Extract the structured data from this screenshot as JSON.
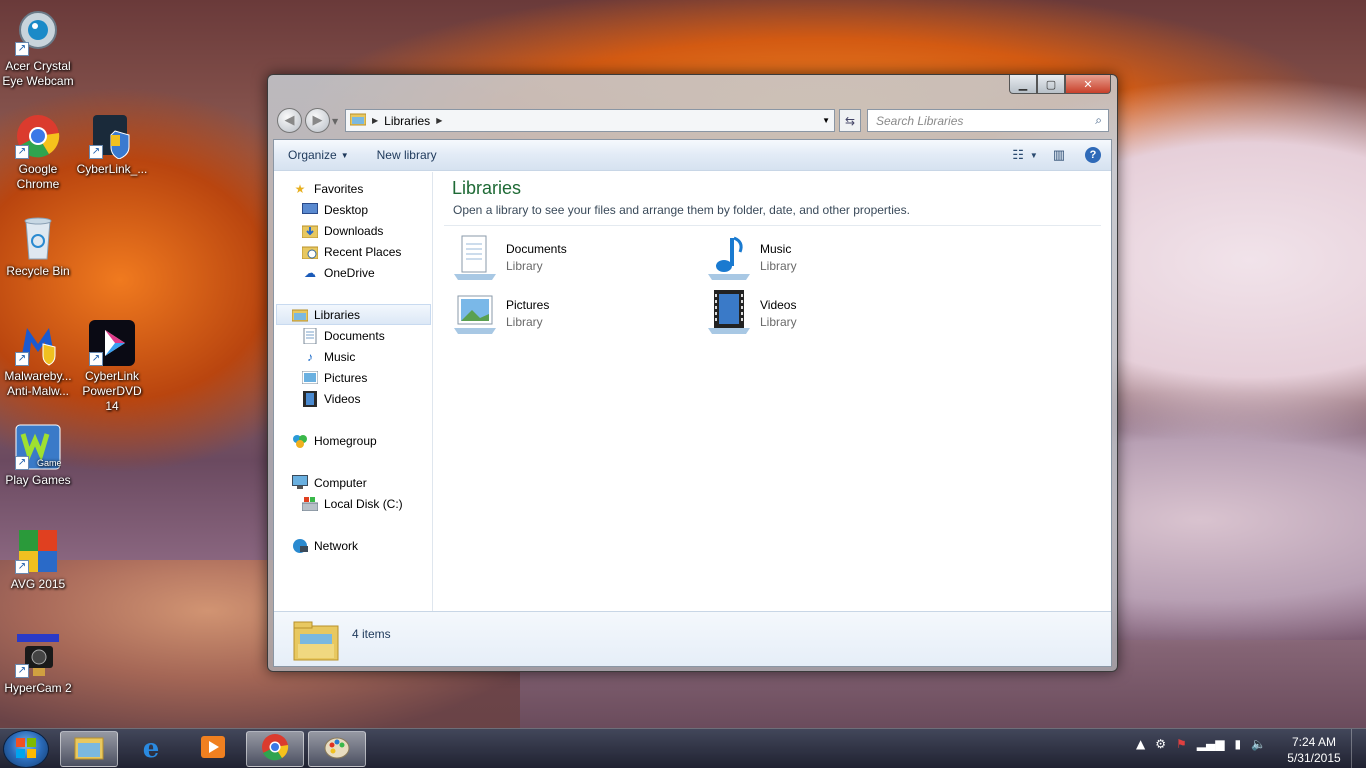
{
  "desktop": {
    "icons": [
      {
        "label": "Acer Crystal Eye Webcam"
      },
      {
        "label": "Google Chrome"
      },
      {
        "label": "CyberLink_..."
      },
      {
        "label": "Recycle Bin"
      },
      {
        "label": "Malwareby... Anti-Malw..."
      },
      {
        "label": "CyberLink PowerDVD 14"
      },
      {
        "label": "Play Games"
      },
      {
        "label": "AVG 2015"
      },
      {
        "label": "HyperCam 2"
      }
    ]
  },
  "window": {
    "address": {
      "crumb": "Libraries"
    },
    "search": {
      "placeholder": "Search Libraries"
    },
    "toolbar": {
      "organize": "Organize",
      "new_library": "New library"
    },
    "nav": {
      "favorites": "Favorites",
      "desktop": "Desktop",
      "downloads": "Downloads",
      "recent": "Recent Places",
      "onedrive": "OneDrive",
      "libraries": "Libraries",
      "documents": "Documents",
      "music": "Music",
      "pictures": "Pictures",
      "videos": "Videos",
      "homegroup": "Homegroup",
      "computer": "Computer",
      "local_disk": "Local Disk (C:)",
      "network": "Network"
    },
    "main": {
      "title": "Libraries",
      "subtitle": "Open a library to see your files and arrange them by folder, date, and other properties.",
      "libraries": [
        {
          "name": "Documents",
          "type": "Library"
        },
        {
          "name": "Music",
          "type": "Library"
        },
        {
          "name": "Pictures",
          "type": "Library"
        },
        {
          "name": "Videos",
          "type": "Library"
        }
      ]
    },
    "details": {
      "count": "4 items"
    }
  },
  "taskbar": {
    "time": "7:24 AM",
    "date": "5/31/2015"
  }
}
